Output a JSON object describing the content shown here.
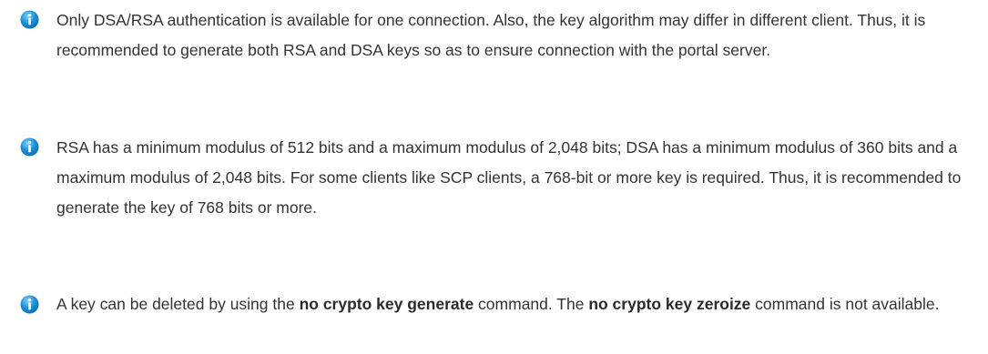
{
  "icons": {
    "info": "info-icon",
    "accent": "#1a8fd6",
    "accent_dark": "#0b6cb0"
  },
  "notes": [
    {
      "text": "Only DSA/RSA authentication is available for one connection. Also, the key algorithm may differ in different client. Thus, it is recommended to generate both RSA and DSA keys so as to ensure connection with the portal server."
    },
    {
      "text": "RSA has a minimum modulus of 512 bits and a maximum modulus of 2,048 bits; DSA has a minimum modulus of 360 bits and a maximum modulus of 2,048 bits. For some clients like SCP clients, a 768-bit or more key is required. Thus, it is recommended to generate the key of 768 bits or more."
    },
    {
      "text_1": "A key can be deleted by using the ",
      "cmd_1": "no crypto key generate",
      "text_2": " command. The ",
      "cmd_2": "no crypto key zeroize",
      "text_3": " command is not available."
    }
  ]
}
